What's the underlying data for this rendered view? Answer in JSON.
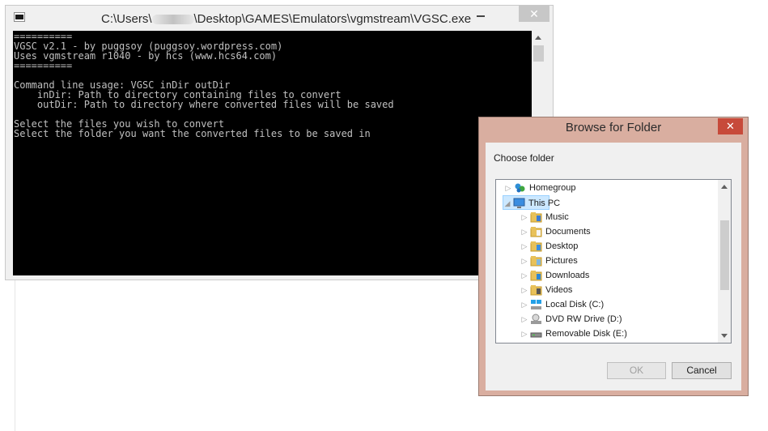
{
  "console": {
    "title_prefix": "C:\\Users\\",
    "title_suffix": "\\Desktop\\GAMES\\Emulators\\vgmstream\\VGSC.exe",
    "close_label": "✕",
    "lines": [
      "==========",
      "VGSC v2.1 - by puggsoy (puggsoy.wordpress.com)",
      "Uses vgmstream r1040 - by hcs (www.hcs64.com)",
      "==========",
      "",
      "Command line usage: VGSC inDir outDir",
      "    inDir: Path to directory containing files to convert",
      "    outDir: Path to directory where converted files will be saved",
      "",
      "Select the files you wish to convert",
      "Select the folder you want the converted files to be saved in"
    ]
  },
  "dialog": {
    "title": "Browse for Folder",
    "close_label": "✕",
    "prompt": "Choose folder",
    "tree": [
      {
        "label": "Homegroup",
        "icon": "homegroup-icon",
        "level": 0,
        "selected": false
      },
      {
        "label": "This PC",
        "icon": "computer-icon",
        "level": 0,
        "selected": true,
        "expanded": true
      },
      {
        "label": "Music",
        "icon": "music-folder-icon",
        "level": 1,
        "selected": false
      },
      {
        "label": "Documents",
        "icon": "documents-folder-icon",
        "level": 1,
        "selected": false
      },
      {
        "label": "Desktop",
        "icon": "desktop-folder-icon",
        "level": 1,
        "selected": false
      },
      {
        "label": "Pictures",
        "icon": "pictures-folder-icon",
        "level": 1,
        "selected": false
      },
      {
        "label": "Downloads",
        "icon": "downloads-folder-icon",
        "level": 1,
        "selected": false
      },
      {
        "label": "Videos",
        "icon": "videos-folder-icon",
        "level": 1,
        "selected": false
      },
      {
        "label": "Local Disk (C:)",
        "icon": "local-disk-icon",
        "level": 1,
        "selected": false
      },
      {
        "label": "DVD RW Drive (D:)",
        "icon": "dvd-drive-icon",
        "level": 1,
        "selected": false
      },
      {
        "label": "Removable Disk (E:)",
        "icon": "removable-disk-icon",
        "level": 1,
        "selected": false
      }
    ],
    "ok_label": "OK",
    "cancel_label": "Cancel"
  },
  "colors": {
    "console_bg": "#000000",
    "console_text": "#c0c0c0",
    "dialog_frame": "#d9aea0",
    "close_red": "#c74a3a",
    "selection": "#cce8ff"
  }
}
